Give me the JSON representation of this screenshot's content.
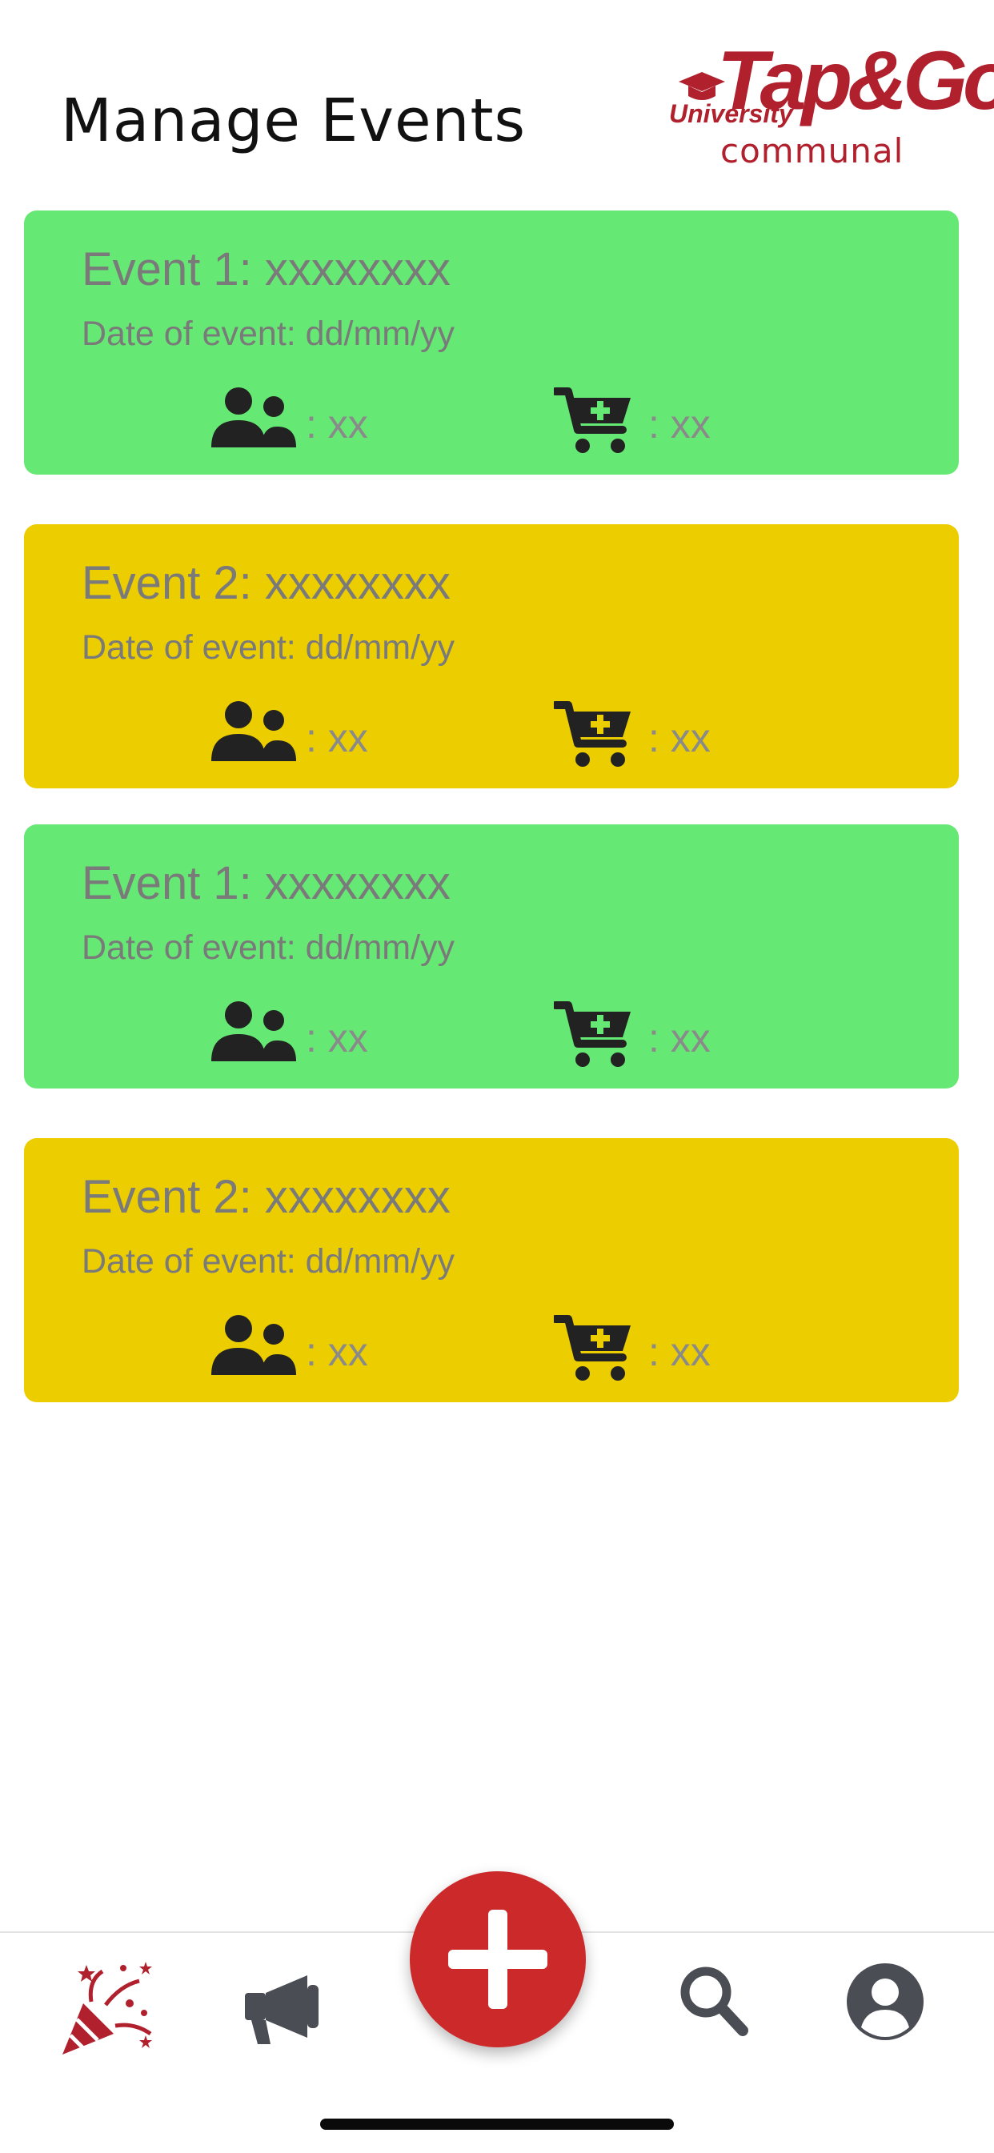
{
  "header": {
    "title": "Manage Events",
    "logo_main": "Tap&Go",
    "logo_university": "University",
    "logo_sub": "communal"
  },
  "colors": {
    "card_green": "#66e874",
    "card_yellow": "#eccd00",
    "brand_red": "#b0202d",
    "fab_red": "#cc2a2a",
    "nav_icon_gray": "#4a4e54"
  },
  "events": [
    {
      "title": "Event 1: xxxxxxxx",
      "date": "Date of event: dd/mm/yy",
      "attendees": ": xx",
      "sales": ": xx",
      "color": "green",
      "attendees_icon": "people-icon",
      "sales_icon": "cart-plus-icon"
    },
    {
      "title": "Event 2: xxxxxxxx",
      "date": "Date of event: dd/mm/yy",
      "attendees": ": xx",
      "sales": ": xx",
      "color": "yellow",
      "attendees_icon": "people-icon",
      "sales_icon": "cart-plus-icon"
    },
    {
      "title": "Event 1: xxxxxxxx",
      "date": "Date of event: dd/mm/yy",
      "attendees": ": xx",
      "sales": ": xx",
      "color": "green",
      "attendees_icon": "people-icon",
      "sales_icon": "cart-plus-icon"
    },
    {
      "title": "Event 2: xxxxxxxx",
      "date": "Date of event: dd/mm/yy",
      "attendees": ": xx",
      "sales": ": xx",
      "color": "yellow",
      "attendees_icon": "people-icon",
      "sales_icon": "cart-plus-icon"
    }
  ],
  "bottom_nav": {
    "items": [
      {
        "icon": "party-popper-icon",
        "active": true
      },
      {
        "icon": "megaphone-icon",
        "active": false
      },
      {
        "icon": "plus-icon",
        "active": false
      },
      {
        "icon": "search-icon",
        "active": false
      },
      {
        "icon": "account-icon",
        "active": false
      }
    ]
  }
}
